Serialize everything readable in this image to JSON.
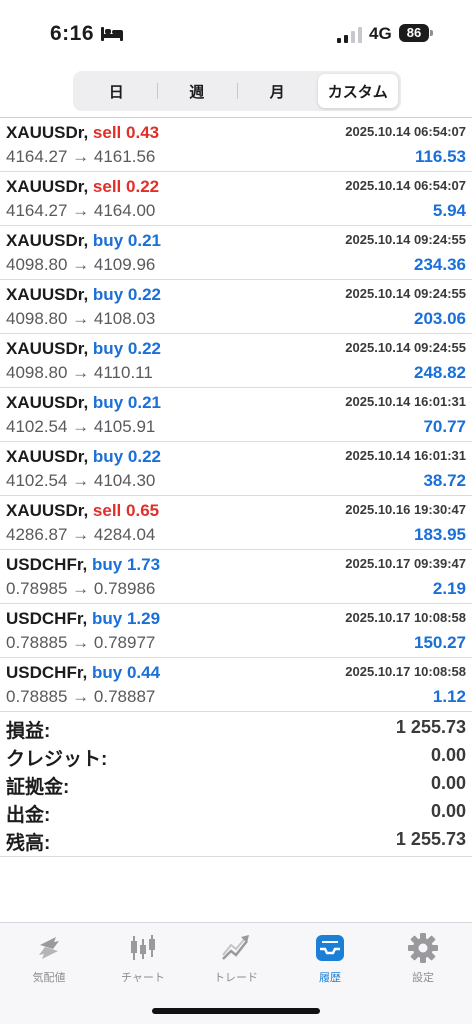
{
  "status_bar": {
    "time": "6:16",
    "network": "4G",
    "battery": "86"
  },
  "period_tabs": [
    {
      "label": "日",
      "active": false
    },
    {
      "label": "週",
      "active": false
    },
    {
      "label": "月",
      "active": false
    },
    {
      "label": "カスタム",
      "active": true
    }
  ],
  "trades": [
    {
      "symbol": "XAUUSDr,",
      "side": "sell",
      "volume": "0.43",
      "datetime": "2025.10.14 06:54:07",
      "prices": "4164.27 → 4161.56",
      "profit": "116.53"
    },
    {
      "symbol": "XAUUSDr,",
      "side": "sell",
      "volume": "0.22",
      "datetime": "2025.10.14 06:54:07",
      "prices": "4164.27 → 4164.00",
      "profit": "5.94"
    },
    {
      "symbol": "XAUUSDr,",
      "side": "buy",
      "volume": "0.21",
      "datetime": "2025.10.14 09:24:55",
      "prices": "4098.80 → 4109.96",
      "profit": "234.36"
    },
    {
      "symbol": "XAUUSDr,",
      "side": "buy",
      "volume": "0.22",
      "datetime": "2025.10.14 09:24:55",
      "prices": "4098.80 → 4108.03",
      "profit": "203.06"
    },
    {
      "symbol": "XAUUSDr,",
      "side": "buy",
      "volume": "0.22",
      "datetime": "2025.10.14 09:24:55",
      "prices": "4098.80 → 4110.11",
      "profit": "248.82"
    },
    {
      "symbol": "XAUUSDr,",
      "side": "buy",
      "volume": "0.21",
      "datetime": "2025.10.14 16:01:31",
      "prices": "4102.54 → 4105.91",
      "profit": "70.77"
    },
    {
      "symbol": "XAUUSDr,",
      "side": "buy",
      "volume": "0.22",
      "datetime": "2025.10.14 16:01:31",
      "prices": "4102.54 → 4104.30",
      "profit": "38.72"
    },
    {
      "symbol": "XAUUSDr,",
      "side": "sell",
      "volume": "0.65",
      "datetime": "2025.10.16 19:30:47",
      "prices": "4286.87 → 4284.04",
      "profit": "183.95"
    },
    {
      "symbol": "USDCHFr,",
      "side": "buy",
      "volume": "1.73",
      "datetime": "2025.10.17 09:39:47",
      "prices": "0.78985 → 0.78986",
      "profit": "2.19"
    },
    {
      "symbol": "USDCHFr,",
      "side": "buy",
      "volume": "1.29",
      "datetime": "2025.10.17 10:08:58",
      "prices": "0.78885 → 0.78977",
      "profit": "150.27"
    },
    {
      "symbol": "USDCHFr,",
      "side": "buy",
      "volume": "0.44",
      "datetime": "2025.10.17 10:08:58",
      "prices": "0.78885 → 0.78887",
      "profit": "1.12"
    }
  ],
  "summary": [
    {
      "label": "損益:",
      "value": "1 255.73"
    },
    {
      "label": "クレジット:",
      "value": "0.00"
    },
    {
      "label": "証拠金:",
      "value": "0.00"
    },
    {
      "label": "出金:",
      "value": "0.00"
    },
    {
      "label": "残高:",
      "value": "1 255.73"
    }
  ],
  "tab_bar": [
    {
      "label": "気配値",
      "icon": "quotes-arrows-icon",
      "active": false
    },
    {
      "label": "チャート",
      "icon": "candlestick-chart-icon",
      "active": false
    },
    {
      "label": "トレード",
      "icon": "trade-line-icon",
      "active": false
    },
    {
      "label": "履歴",
      "icon": "history-inbox-icon",
      "active": true
    },
    {
      "label": "設定",
      "icon": "gear-icon",
      "active": false
    }
  ],
  "colors": {
    "sell": "#e0302a",
    "buy": "#1a6fd8",
    "profit": "#1a6fd8",
    "active_tab": "#1a7fd6",
    "inactive_tab": "#8e8e93"
  }
}
